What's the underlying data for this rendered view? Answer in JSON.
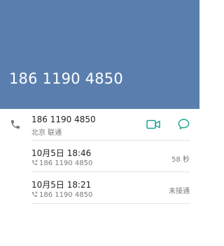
{
  "header": {
    "number": "186 1190 4850"
  },
  "contact": {
    "number": "186 1190 4850",
    "location": "北京 联通",
    "icons": {
      "phone": "phone-icon",
      "video": "video-call-icon",
      "message": "message-icon"
    },
    "accent_color": "#1aa393"
  },
  "call_log": [
    {
      "time": "10月5日 18:46",
      "number": "186 1190 4850",
      "status": "58 秒",
      "icon": "outgoing-call-icon"
    },
    {
      "time": "10月5日 18:21",
      "number": "186 1190 4850",
      "status": "未接通",
      "icon": "outgoing-call-icon"
    }
  ],
  "colors": {
    "header": "#5a7fae",
    "accent": "#1aa393",
    "secondary_text": "#7a7a7a"
  }
}
